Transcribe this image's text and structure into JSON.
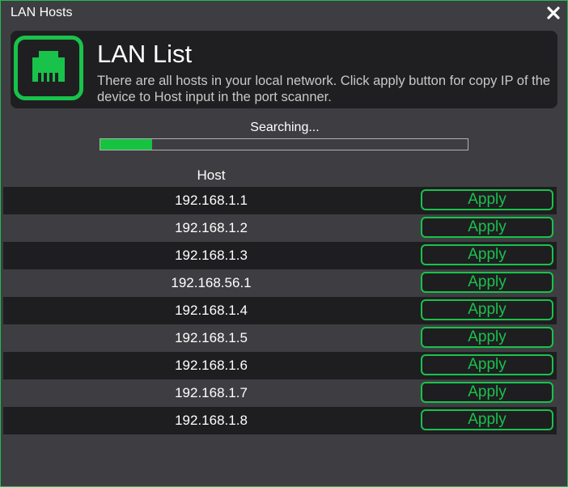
{
  "window": {
    "title": "LAN Hosts"
  },
  "header": {
    "icon": "ethernet-port-icon",
    "title": "LAN List",
    "description": "There are all hosts in your local network. Click apply button for copy IP of the device to Host input in the port scanner."
  },
  "scan": {
    "status": "Searching...",
    "progress": 0.14
  },
  "table": {
    "column_header": "Host",
    "action_label": "Apply",
    "rows": [
      {
        "host": "192.168.1.1"
      },
      {
        "host": "192.168.1.2"
      },
      {
        "host": "192.168.1.3"
      },
      {
        "host": "192.168.56.1"
      },
      {
        "host": "192.168.1.4"
      },
      {
        "host": "192.168.1.5"
      },
      {
        "host": "192.168.1.6"
      },
      {
        "host": "192.168.1.7"
      },
      {
        "host": "192.168.1.8"
      }
    ]
  },
  "colors": {
    "accent": "#19c24a",
    "background": "#3e3e42",
    "row_dark": "#1e1e21",
    "text": "#ffffff"
  }
}
